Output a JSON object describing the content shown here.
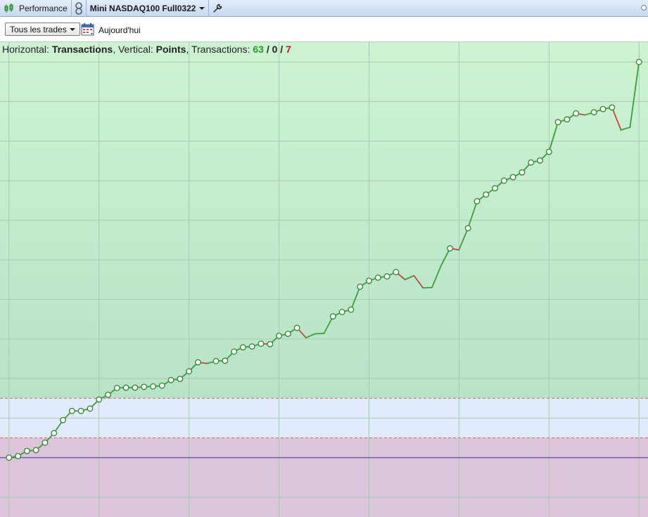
{
  "titlebar": {
    "panel_label": "Performance",
    "instrument_label": "Mini NASDAQ100 Full0322"
  },
  "toolbar": {
    "filter_selected": "Tous les trades",
    "date_label": "Aujourd'hui"
  },
  "chart_info": {
    "h_label": "Horizontal: ",
    "h_value": "Transactions",
    "v_label": ", Vertical: ",
    "v_value": "Points",
    "t_label": ", Transactions: ",
    "wins": "63",
    "sep1": " / ",
    "even": "0",
    "sep2": " / ",
    "losses": "7"
  },
  "colors": {
    "win": "#3aa03a",
    "loss": "#cc4444",
    "upper_zone": "#c9efcf",
    "lower_zone": "#dcc4da",
    "mid_zone": "#e2eafd",
    "baseline": "#7a5ab0"
  },
  "chart_data": {
    "type": "line",
    "xlabel": "Transactions",
    "ylabel": "Points",
    "xlim": [
      0,
      72
    ],
    "ylim": [
      -1.5,
      10.5
    ],
    "grid": true,
    "x_grid_step": 10,
    "y_grid_step": 1,
    "zero_line": 0,
    "band_upper": 1.5,
    "band_lower": 0.5,
    "series": [
      {
        "values": [
          0,
          0.04,
          0.17,
          0.19,
          0.38,
          0.62,
          0.95,
          1.18,
          1.18,
          1.24,
          1.47,
          1.59,
          1.76,
          1.77,
          1.77,
          1.79,
          1.8,
          1.82,
          1.96,
          1.99,
          2.18,
          2.41,
          2.38,
          2.44,
          2.45,
          2.68,
          2.79,
          2.81,
          2.88,
          2.87,
          3.08,
          3.13,
          3.28,
          3.03,
          3.13,
          3.14,
          3.57,
          3.68,
          3.74,
          4.32,
          4.47,
          4.55,
          4.58,
          4.69,
          4.5,
          4.6,
          4.29,
          4.3,
          4.85,
          5.29,
          5.25,
          5.8,
          6.48,
          6.65,
          6.81,
          7.0,
          7.09,
          7.21,
          7.46,
          7.51,
          7.73,
          8.48,
          8.55,
          8.7,
          8.66,
          8.73,
          8.81,
          8.85,
          8.28,
          8.35,
          10.0
        ],
        "markers": [
          1,
          1,
          1,
          1,
          1,
          1,
          1,
          1,
          1,
          1,
          1,
          1,
          1,
          1,
          1,
          1,
          1,
          1,
          1,
          1,
          1,
          1,
          0,
          1,
          1,
          1,
          1,
          1,
          1,
          1,
          1,
          1,
          1,
          0,
          0,
          0,
          1,
          1,
          1,
          1,
          1,
          1,
          1,
          1,
          0,
          0,
          0,
          0,
          0,
          1,
          0,
          1,
          1,
          1,
          1,
          1,
          1,
          1,
          1,
          1,
          1,
          1,
          1,
          1,
          0,
          1,
          1,
          1,
          0,
          0,
          1
        ]
      }
    ]
  }
}
